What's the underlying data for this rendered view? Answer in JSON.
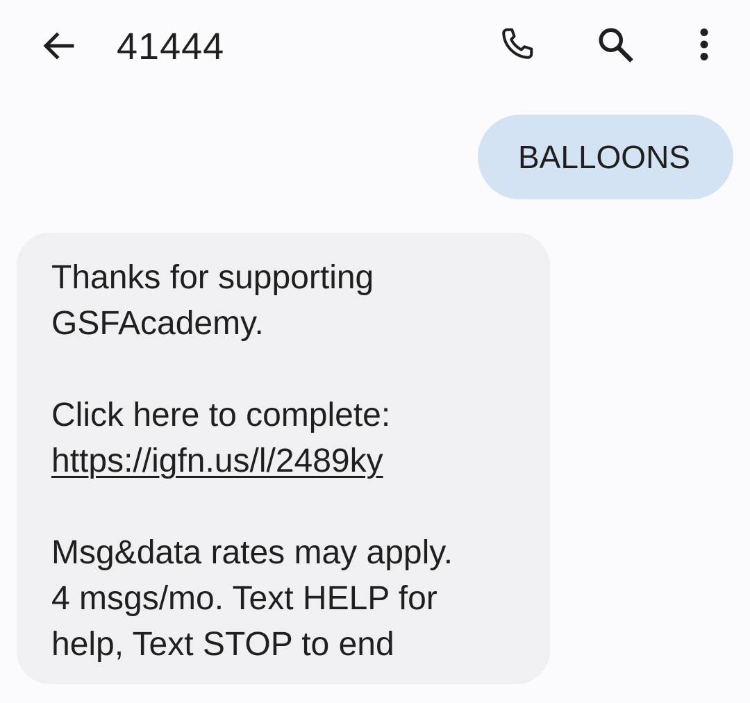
{
  "header": {
    "title": "41444",
    "icons": {
      "back": "arrow-back-icon",
      "call": "phone-icon",
      "search": "search-icon",
      "more": "more-vert-icon"
    }
  },
  "conversation": {
    "outgoing": {
      "text": "BALLOONS",
      "bubble_color": "#d3e3f4"
    },
    "incoming": {
      "bubble_color": "#f0f0f2",
      "lines": [
        "Thanks for supporting",
        "GSFAcademy.",
        "Click here to complete:",
        "https://igfn.us/l/2489ky",
        "Msg&data rates may apply.",
        "4 msgs/mo. Text HELP for",
        "help, Text STOP to end"
      ]
    }
  }
}
